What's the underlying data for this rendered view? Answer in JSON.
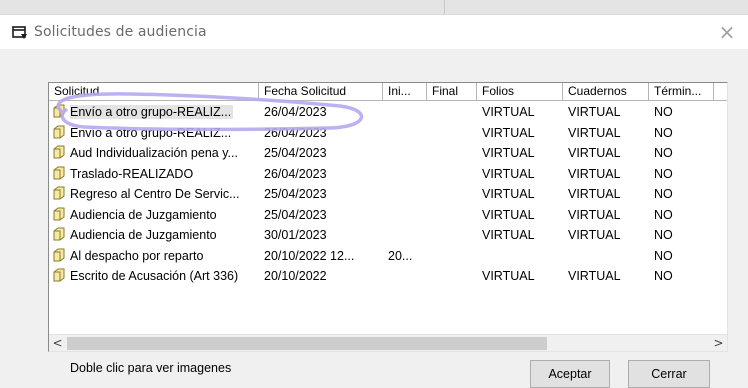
{
  "window": {
    "title": "Solicitudes de audiencia",
    "close_glyph": "×",
    "icon": "form-window-icon"
  },
  "list": {
    "columns": [
      "Solicitud",
      "Fecha Solicitud",
      "Ini...",
      "Final",
      "Folios",
      "Cuadernos",
      "Térmi­n..."
    ],
    "rows": [
      [
        "Envío a otro grupo-REALIZ...",
        "26/04/2023",
        "",
        "",
        "VIRTUAL",
        "VIRTUAL",
        "NO"
      ],
      [
        "Envío a otro grupo-REALIZ...",
        "26/04/2023",
        "",
        "",
        "VIRTUAL",
        "VIRTUAL",
        "NO"
      ],
      [
        "Aud Individualización pena y...",
        "25/04/2023",
        "",
        "",
        "VIRTUAL",
        "VIRTUAL",
        "NO"
      ],
      [
        "Traslado-REALIZADO",
        "26/04/2023",
        "",
        "",
        "VIRTUAL",
        "VIRTUAL",
        "NO"
      ],
      [
        "Regreso al Centro De Servic...",
        "25/04/2023",
        "",
        "",
        "VIRTUAL",
        "VIRTUAL",
        "NO"
      ],
      [
        "Audiencia de Juzgamiento",
        "25/04/2023",
        "",
        "",
        "VIRTUAL",
        "VIRTUAL",
        "NO"
      ],
      [
        "Audiencia de Juzgamiento",
        "30/01/2023",
        "",
        "",
        "VIRTUAL",
        "VIRTUAL",
        "NO"
      ],
      [
        "Al despacho por reparto",
        "20/10/2022 12...",
        "20...",
        "",
        "",
        "",
        "NO"
      ],
      [
        "Escrito de Acusación (Art 336)",
        "20/10/2022",
        "",
        "",
        "VIRTUAL",
        "VIRTUAL",
        "NO"
      ]
    ],
    "selected_row": 0,
    "row_icon": "folder-icon",
    "scroll_left": "<",
    "scroll_right": ">"
  },
  "footer": {
    "hint": "Doble clic para ver imagenes",
    "accept_label": "Aceptar",
    "close_label": "Cerrar"
  },
  "colors": {
    "annotation_stroke": "#b8a8f0",
    "folder_fill": "#f6e9a6",
    "folder_stroke": "#8a7a2a"
  }
}
